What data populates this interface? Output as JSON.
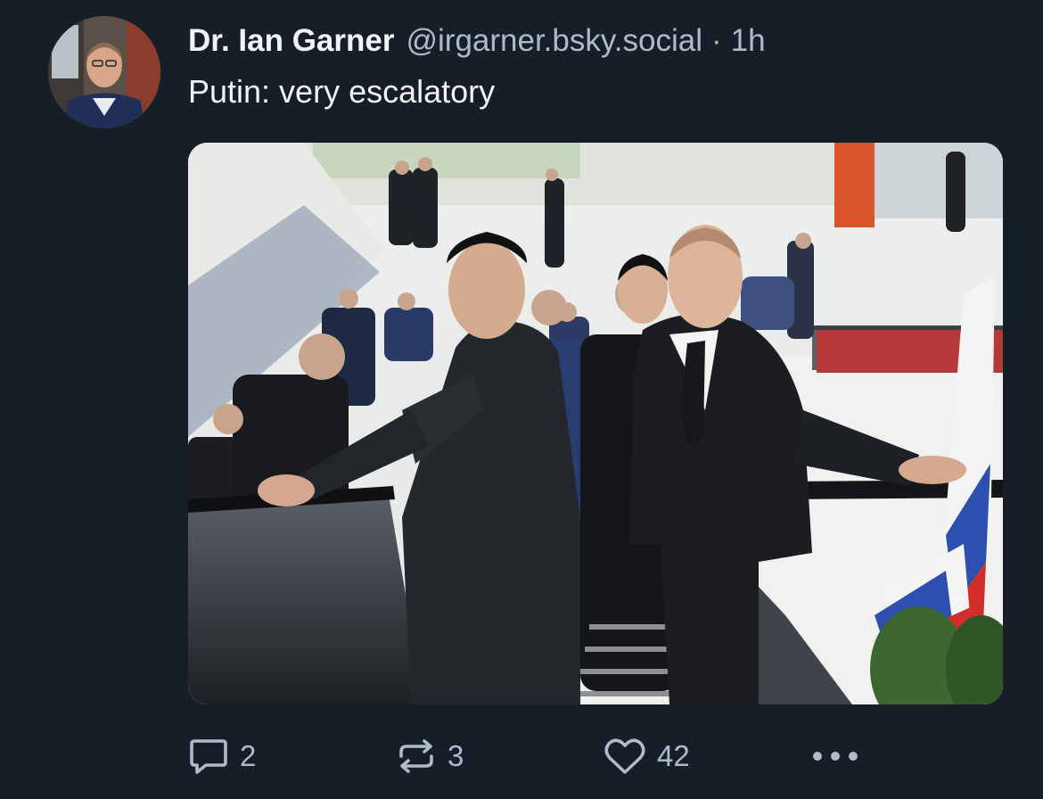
{
  "post": {
    "author": {
      "display_name": "Dr. Ian Garner",
      "handle": "@irgarner.bsky.social",
      "separator": "·",
      "time_ago": "1h",
      "avatar_icon": "profile-photo"
    },
    "text": "Putin: very escalatory",
    "media": {
      "description_icon": "photo-escalator-meeting"
    },
    "actions": {
      "reply": {
        "icon": "speech-bubble-icon",
        "count": "2"
      },
      "repost": {
        "icon": "repost-arrows-icon",
        "count": "3"
      },
      "like": {
        "icon": "heart-icon",
        "count": "42"
      },
      "more": {
        "icon": "ellipsis-icon"
      }
    }
  },
  "colors": {
    "background": "#161e27",
    "text_primary": "#f1f3f5",
    "text_secondary": "#aebbc9"
  }
}
